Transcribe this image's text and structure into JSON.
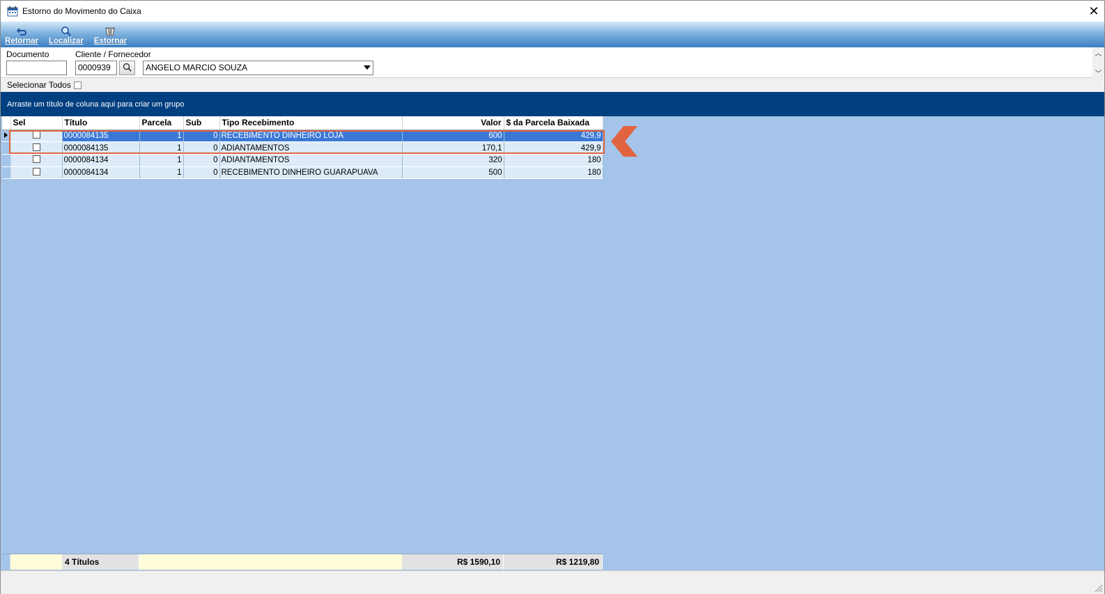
{
  "window": {
    "title": "Estorno do Movimento do Caixa",
    "icon": "calendar-app-icon",
    "close_label": "✕"
  },
  "toolbar": {
    "buttons": [
      {
        "label": "Retornar",
        "icon": "return-arrow-icon"
      },
      {
        "label": "Localizar",
        "icon": "magnifier-icon"
      },
      {
        "label": "Estornar",
        "icon": "trash-basket-icon"
      }
    ]
  },
  "filter": {
    "documento_label": "Documento",
    "documento_value": "",
    "cliente_label": "Cliente / Fornecedor",
    "cliente_code": "0000939",
    "cliente_name": "ANGELO MARCIO SOUZA"
  },
  "select_all_label": "Selecionar Todos",
  "group_hint": "Arraste um título de coluna aqui para criar um grupo",
  "grid": {
    "columns": [
      "Sel",
      "Título",
      "Parcela",
      "Sub",
      "Tipo Recebimento",
      "Valor",
      "$ da Parcela Baixada"
    ],
    "rows": [
      {
        "titulo": "0000084135",
        "parcela": "1",
        "sub": "0",
        "tipo": "RECEBIMENTO DINHEIRO LOJA",
        "valor": "600",
        "baixada": "429,9"
      },
      {
        "titulo": "0000084135",
        "parcela": "1",
        "sub": "0",
        "tipo": "ADIANTAMENTOS",
        "valor": "170,1",
        "baixada": "429,9"
      },
      {
        "titulo": "0000084134",
        "parcela": "1",
        "sub": "0",
        "tipo": "ADIANTAMENTOS",
        "valor": "320",
        "baixada": "180"
      },
      {
        "titulo": "0000084134",
        "parcela": "1",
        "sub": "0",
        "tipo": "RECEBIMENTO DINHEIRO GUARAPUAVA",
        "valor": "500",
        "baixada": "180"
      }
    ],
    "footer": {
      "count": "4 Títulos",
      "valor_total": "R$ 1590,10",
      "baixada_total": "R$ 1219,80"
    }
  },
  "colors": {
    "grid_background": "#a4c4e9",
    "group_bar": "#003f80",
    "selected_row": "#3b78d6",
    "annotation": "#e2633f"
  }
}
